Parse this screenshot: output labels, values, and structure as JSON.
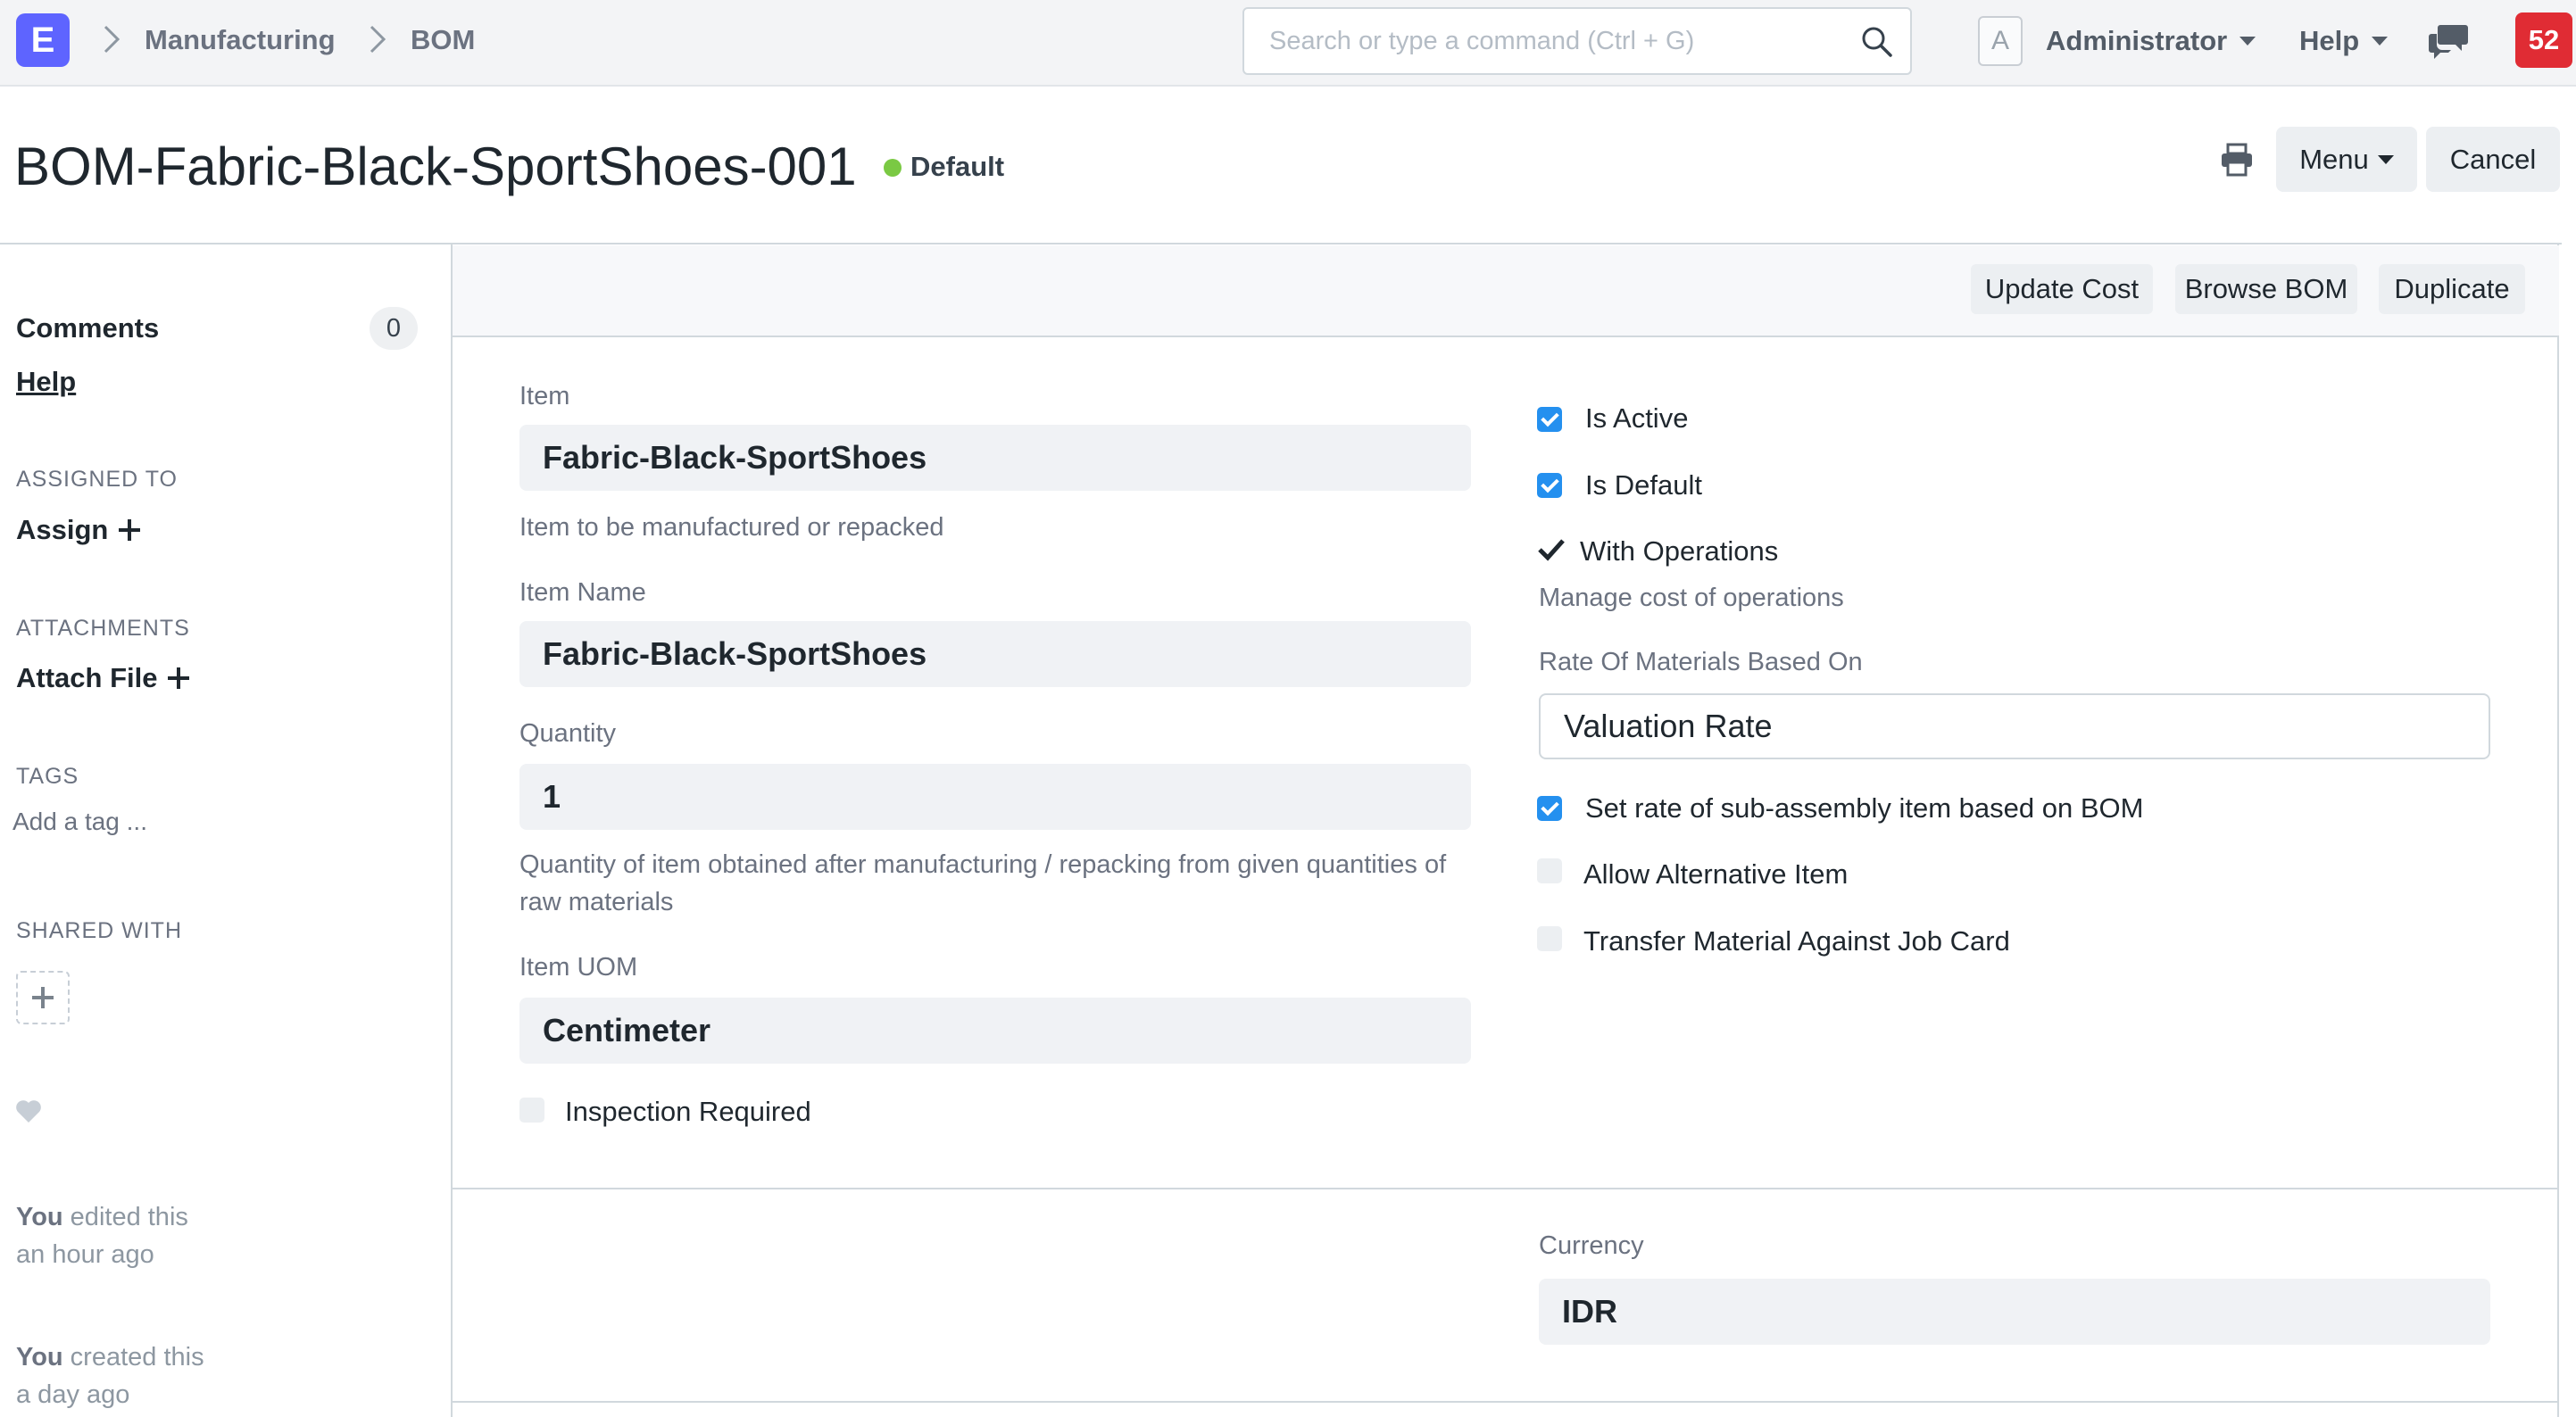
{
  "navbar": {
    "logo": "E",
    "breadcrumbs": [
      "Manufacturing",
      "BOM"
    ],
    "search_placeholder": "Search or type a command (Ctrl + G)",
    "avatar_letter": "A",
    "user_label": "Administrator",
    "help_label": "Help",
    "notification_count": "52"
  },
  "page": {
    "title": "BOM-Fabric-Black-SportShoes-001",
    "status": "Default",
    "status_color": "#7ac943",
    "menu_label": "Menu",
    "cancel_label": "Cancel"
  },
  "toolbar": {
    "update_cost": "Update Cost",
    "browse_bom": "Browse BOM",
    "duplicate": "Duplicate"
  },
  "sidebar": {
    "comments_label": "Comments",
    "comments_count": "0",
    "help_label": "Help",
    "assigned_to_heading": "ASSIGNED TO",
    "assign_label": "Assign",
    "attachments_heading": "ATTACHMENTS",
    "attach_label": "Attach File",
    "tags_heading": "TAGS",
    "add_tag_label": "Add a tag ...",
    "shared_heading": "SHARED WITH",
    "timeline": [
      {
        "who": "You",
        "line1": " edited this",
        "line2": "an hour ago"
      },
      {
        "who": "You",
        "line1": " created this",
        "line2": "a day ago"
      }
    ]
  },
  "form": {
    "item": {
      "label": "Item",
      "value": "Fabric-Black-SportShoes",
      "description": "Item to be manufactured or repacked"
    },
    "item_name": {
      "label": "Item Name",
      "value": "Fabric-Black-SportShoes"
    },
    "quantity": {
      "label": "Quantity",
      "value": "1",
      "description": "Quantity of item obtained after manufacturing / repacking from given quantities of raw materials"
    },
    "item_uom": {
      "label": "Item UOM",
      "value": "Centimeter"
    },
    "inspection_required": {
      "label": "Inspection Required",
      "checked": false
    },
    "is_active": {
      "label": "Is Active",
      "checked": true
    },
    "is_default": {
      "label": "Is Default",
      "checked": true
    },
    "with_operations": {
      "label": "With Operations",
      "checked": true,
      "description": "Manage cost of operations"
    },
    "rate_of_materials": {
      "label": "Rate Of Materials Based On",
      "value": "Valuation Rate"
    },
    "set_rate_sub_assembly": {
      "label": "Set rate of sub-assembly item based on BOM",
      "checked": true
    },
    "allow_alternative": {
      "label": "Allow Alternative Item",
      "checked": false
    },
    "transfer_material": {
      "label": "Transfer Material Against Job Card",
      "checked": false
    },
    "currency": {
      "label": "Currency",
      "value": "IDR"
    }
  },
  "colors": {
    "accent": "#2490ef",
    "logo": "#5e64ff",
    "notification": "#e02c34"
  }
}
